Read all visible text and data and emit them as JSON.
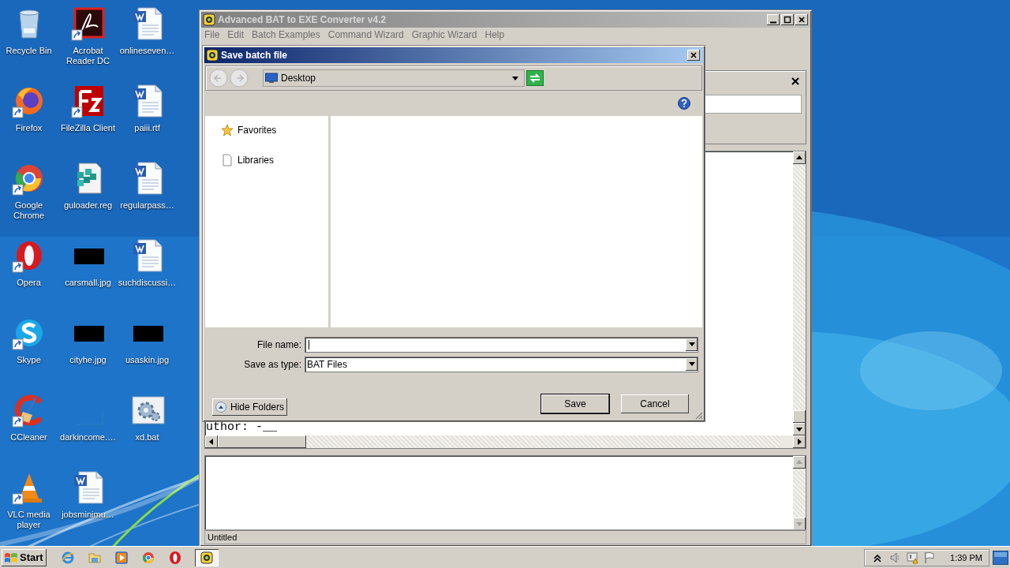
{
  "desktop": {
    "icons": [
      {
        "label": "Recycle Bin",
        "kind": "recycle",
        "shortcut": false
      },
      {
        "label": "Firefox",
        "kind": "firefox",
        "shortcut": true
      },
      {
        "label": "Google Chrome",
        "kind": "chrome",
        "shortcut": true
      },
      {
        "label": "Opera",
        "kind": "opera",
        "shortcut": true
      },
      {
        "label": "Skype",
        "kind": "skype",
        "shortcut": true
      },
      {
        "label": "CCleaner",
        "kind": "ccleaner",
        "shortcut": true
      },
      {
        "label": "VLC media player",
        "kind": "vlc",
        "shortcut": true
      },
      {
        "label": "Acrobat Reader DC",
        "kind": "acrobat",
        "shortcut": true
      },
      {
        "label": "FileZilla Client",
        "kind": "filezilla",
        "shortcut": true
      },
      {
        "label": "guloader.reg",
        "kind": "reg",
        "shortcut": false
      },
      {
        "label": "carsmall.jpg",
        "shortcut": false
      },
      {
        "label": "cityhe.jpg",
        "shortcut": false
      },
      {
        "label": "darkincome.…",
        "kind": "blank",
        "shortcut": false
      },
      {
        "label": "jobsminimu…",
        "kind": "word",
        "shortcut": false
      },
      {
        "label": "onlineseven…",
        "kind": "word",
        "shortcut": false
      },
      {
        "label": "paiii.rtf",
        "kind": "word",
        "shortcut": false
      },
      {
        "label": "regularpass…",
        "kind": "word",
        "shortcut": false
      },
      {
        "label": "suchdiscussi…",
        "kind": "word",
        "shortcut": false
      },
      {
        "label": "usaskin.jpg",
        "shortcut": false
      },
      {
        "label": "xd.bat",
        "kind": "bat",
        "shortcut": false
      }
    ]
  },
  "main_window": {
    "title": "Advanced BAT to EXE Converter v4.2",
    "active": false,
    "menu": [
      "File",
      "Edit",
      "Batch Examples",
      "Command Wizard",
      "Graphic Wizard",
      "Help"
    ],
    "editor_line": "uthor: -__",
    "status_bar": "Untitled"
  },
  "dialog": {
    "title": "Save batch file",
    "nav_buttons": [
      {
        "kind": "back",
        "disabled": true
      },
      {
        "kind": "forward",
        "disabled": true
      }
    ],
    "location": "Desktop",
    "folders": [
      {
        "label": "Favorites",
        "kind": "star"
      },
      {
        "label": "Libraries",
        "kind": "page"
      }
    ],
    "fields": [
      {
        "label": "File name:",
        "kind": "input"
      },
      {
        "label": "Save as type:",
        "kind": "select",
        "value": "BAT Files"
      }
    ],
    "hide_folders": "Hide Folders",
    "buttons": [
      {
        "label": "Save",
        "default": true
      },
      {
        "label": "Cancel",
        "default": false
      }
    ]
  },
  "taskbar": {
    "start": "Start",
    "quick_launch": [
      {
        "kind": "ie"
      },
      {
        "kind": "folder"
      },
      {
        "kind": "media"
      },
      {
        "kind": "chrome"
      },
      {
        "kind": "opera"
      }
    ],
    "tasks": [
      {
        "kind": "app",
        "selected": true
      }
    ],
    "tray": [
      {
        "kind": "chevron"
      },
      {
        "kind": "speaker"
      },
      {
        "kind": "network"
      },
      {
        "kind": "flag"
      }
    ],
    "clock": "1:39 PM"
  }
}
